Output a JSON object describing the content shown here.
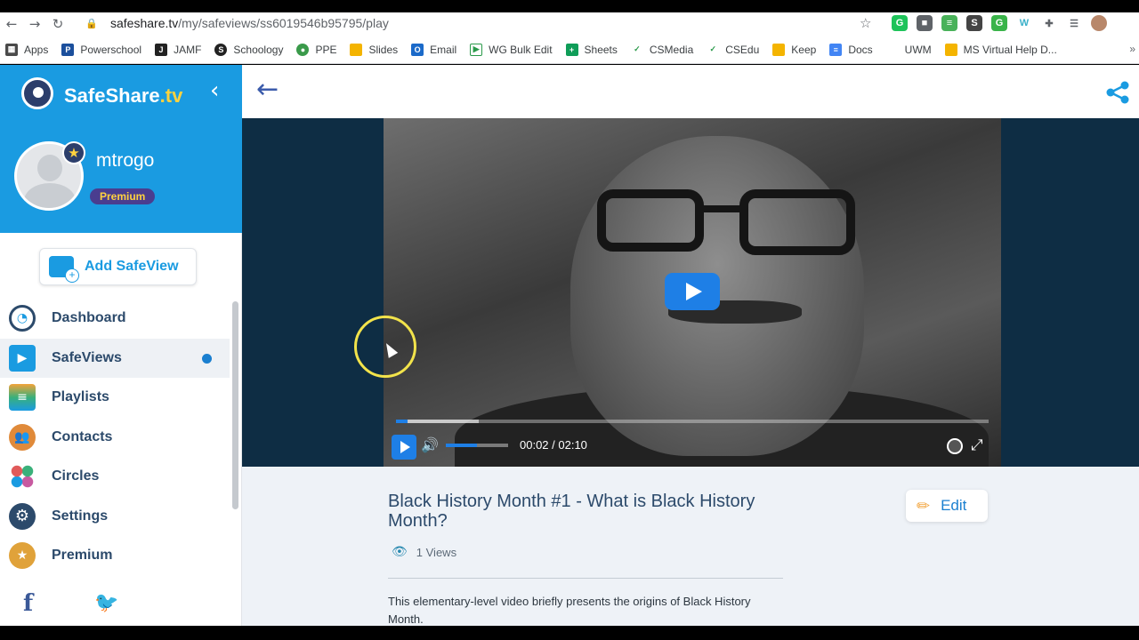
{
  "browser": {
    "url_host": "safeshare.tv",
    "url_path": "/my/safeviews/ss6019546b95795/play",
    "bookmarks": [
      "Apps",
      "Powerschool",
      "JAMF",
      "Schoology",
      "PPE",
      "Slides",
      "Email",
      "WG Bulk Edit",
      "Sheets",
      "CSMedia",
      "CSEdu",
      "Keep",
      "Docs",
      "UWM",
      "MS Virtual Help D..."
    ],
    "more": "»"
  },
  "sidebar": {
    "brand": "SafeShare",
    "brand_suffix": ".tv",
    "username": "mtrogo",
    "tier": "Premium",
    "add_label": "Add SafeView",
    "items": [
      {
        "label": "Dashboard",
        "icon": "dashboard-icon",
        "color": "#2c4a6b"
      },
      {
        "label": "SafeViews",
        "icon": "safeviews-icon",
        "color": "#1a9be1"
      },
      {
        "label": "Playlists",
        "icon": "playlists-icon",
        "color": "#3ab07a"
      },
      {
        "label": "Contacts",
        "icon": "contacts-icon",
        "color": "#e08a3a"
      },
      {
        "label": "Circles",
        "icon": "circles-icon",
        "color": "#c75aa0"
      },
      {
        "label": "Settings",
        "icon": "gear-icon",
        "color": "#2c4a6b"
      },
      {
        "label": "Premium",
        "icon": "premium-icon",
        "color": "#e0a23a"
      }
    ]
  },
  "player": {
    "time": "00:02 / 02:10",
    "progress": 0.02,
    "buffered": 0.14,
    "volume": 0.5
  },
  "video_info": {
    "title": "Black History Month #1 - What is Black History Month?",
    "edit_label": "Edit",
    "views": "1 Views",
    "description": "This elementary-level video briefly presents the origins of Black History Month."
  },
  "colors": {
    "accent": "#1a9be1",
    "play": "#1e7fe6"
  }
}
